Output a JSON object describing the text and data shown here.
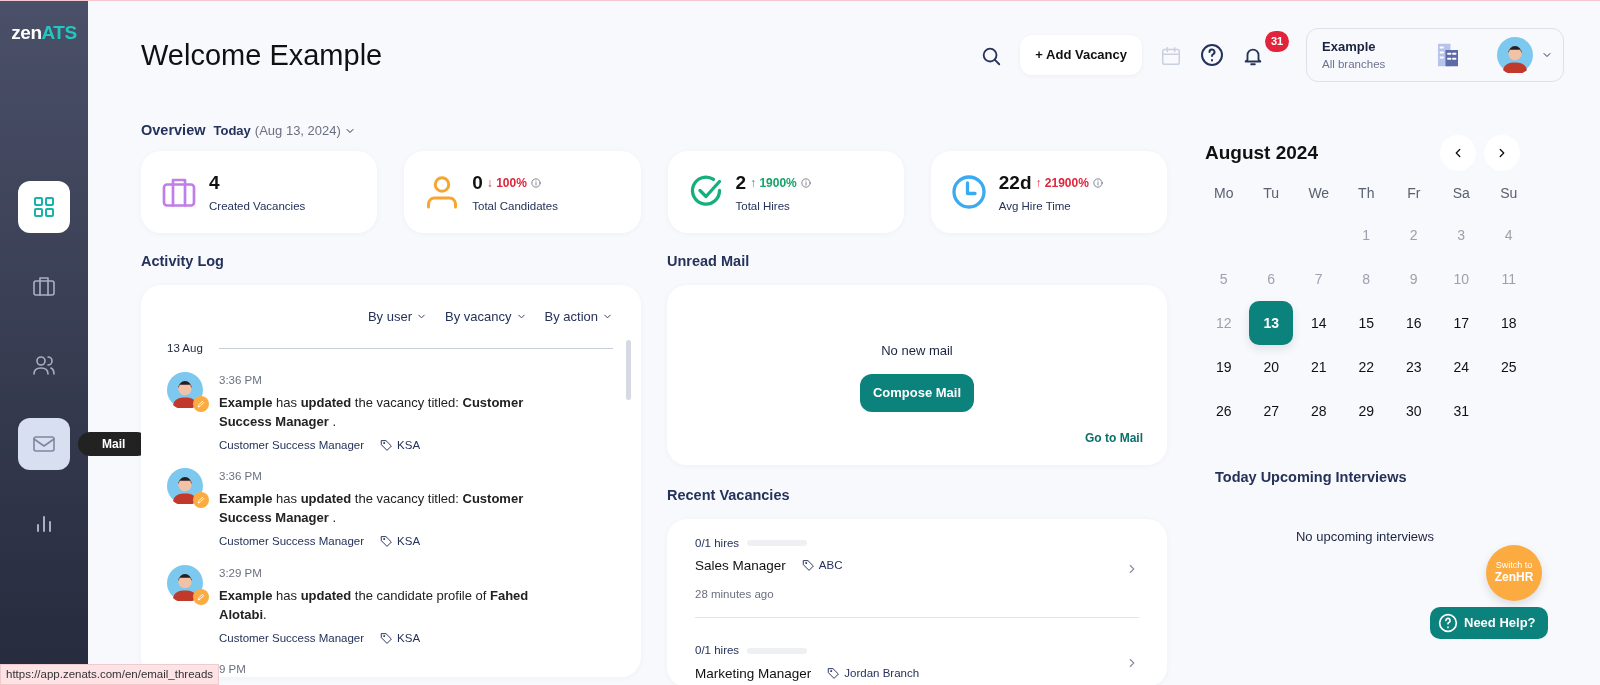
{
  "logo": {
    "part1": "zen",
    "part2": "ATS"
  },
  "sidebar": {
    "items": [
      {
        "kind": "dashboard",
        "selected": true,
        "hovered": false
      },
      {
        "kind": "vacancies",
        "selected": false,
        "hovered": false
      },
      {
        "kind": "candidates",
        "selected": false,
        "hovered": false
      },
      {
        "kind": "mail",
        "selected": false,
        "hovered": true,
        "tooltip": "Mail"
      },
      {
        "kind": "reports",
        "selected": false,
        "hovered": false
      }
    ]
  },
  "header": {
    "title": "Welcome Example",
    "add_button": "+ Add Vacancy",
    "calendar_disabled": true,
    "notifications": "31",
    "account": {
      "name": "Example",
      "scope": "All branches"
    }
  },
  "overview": {
    "title": "Overview",
    "period": "Today",
    "date": "(Aug 13, 2024)",
    "stats": [
      {
        "kind": "briefcase",
        "value": "4",
        "label": "Created Vacancies"
      },
      {
        "kind": "person",
        "value": "0",
        "delta": "↓ 100%",
        "color": "#e0243b",
        "label": "Total Candidates"
      },
      {
        "kind": "check",
        "value": "2",
        "delta": "↑ 1900%",
        "color": "#14a46a",
        "label": "Total Hires"
      },
      {
        "kind": "clock",
        "value": "22d",
        "delta": "↑ 21900%",
        "color": "#e0243b",
        "label": "Avg Hire Time"
      }
    ]
  },
  "activity_log": {
    "title": "Activity Log",
    "filters": [
      "By user",
      "By vacancy",
      "By action"
    ],
    "date": "13 Aug",
    "entries": [
      {
        "time": "3:36 PM",
        "text": "**Example** has **updated** the vacancy titled: **Customer Success Manager** .",
        "vacancy": "Customer Success Manager",
        "tag": "KSA"
      },
      {
        "time": "3:36 PM",
        "text": "**Example** has **updated** the vacancy titled: **Customer Success Manager** .",
        "vacancy": "Customer Success Manager",
        "tag": "KSA"
      },
      {
        "time": "3:29 PM",
        "text": "**Example** has **updated** the candidate profile of **Fahed Alotabi**.",
        "vacancy": "Customer Success Manager",
        "tag": "KSA"
      },
      {
        "time": "9 PM"
      }
    ]
  },
  "unread_mail": {
    "title": "Unread Mail",
    "empty_text": "No new mail",
    "compose": "Compose Mail",
    "link": "Go to Mail"
  },
  "recent_vacancies": {
    "title": "Recent Vacancies",
    "items": [
      {
        "hires": "0/1 hires",
        "level": 0,
        "title": "Sales Manager",
        "tag": "ABC",
        "time": "28 minutes ago"
      },
      {
        "hires": "0/1 hires",
        "level": 0,
        "title": "Marketing Manager",
        "tag": "Jordan Branch"
      }
    ]
  },
  "calendar": {
    "month": "August 2024",
    "weekdays": [
      "Mo",
      "Tu",
      "We",
      "Th",
      "Fr",
      "Sa",
      "Su"
    ],
    "weeks": [
      [
        {
          "kind": "blank"
        },
        {
          "kind": "blank"
        },
        {
          "kind": "blank"
        },
        {
          "kind": "day",
          "day": "1",
          "past": true,
          "selected": false
        },
        {
          "kind": "day",
          "day": "2",
          "past": true,
          "selected": false
        },
        {
          "kind": "day",
          "day": "3",
          "past": true,
          "selected": false
        },
        {
          "kind": "day",
          "day": "4",
          "past": true,
          "selected": false
        }
      ],
      [
        {
          "kind": "day",
          "day": "5",
          "past": true,
          "selected": false
        },
        {
          "kind": "day",
          "day": "6",
          "past": true,
          "selected": false
        },
        {
          "kind": "day",
          "day": "7",
          "past": true,
          "selected": false
        },
        {
          "kind": "day",
          "day": "8",
          "past": true,
          "selected": false
        },
        {
          "kind": "day",
          "day": "9",
          "past": true,
          "selected": false
        },
        {
          "kind": "day",
          "day": "10",
          "past": true,
          "selected": false
        },
        {
          "kind": "day",
          "day": "11",
          "past": true,
          "selected": false
        }
      ],
      [
        {
          "kind": "day",
          "day": "12",
          "past": true,
          "selected": false
        },
        {
          "kind": "day",
          "day": "13",
          "past": false,
          "selected": true
        },
        {
          "kind": "day",
          "day": "14",
          "past": false,
          "selected": false
        },
        {
          "kind": "day",
          "day": "15",
          "past": false,
          "selected": false
        },
        {
          "kind": "day",
          "day": "16",
          "past": false,
          "selected": false
        },
        {
          "kind": "day",
          "day": "17",
          "past": false,
          "selected": false
        },
        {
          "kind": "day",
          "day": "18",
          "past": false,
          "selected": false
        }
      ],
      [
        {
          "kind": "day",
          "day": "19",
          "past": false,
          "selected": false
        },
        {
          "kind": "day",
          "day": "20",
          "past": false,
          "selected": false
        },
        {
          "kind": "day",
          "day": "21",
          "past": false,
          "selected": false
        },
        {
          "kind": "day",
          "day": "22",
          "past": false,
          "selected": false
        },
        {
          "kind": "day",
          "day": "23",
          "past": false,
          "selected": false
        },
        {
          "kind": "day",
          "day": "24",
          "past": false,
          "selected": false
        },
        {
          "kind": "day",
          "day": "25",
          "past": false,
          "selected": false
        }
      ],
      [
        {
          "kind": "day",
          "day": "26",
          "past": false,
          "selected": false
        },
        {
          "kind": "day",
          "day": "27",
          "past": false,
          "selected": false
        },
        {
          "kind": "day",
          "day": "28",
          "past": false,
          "selected": false
        },
        {
          "kind": "day",
          "day": "29",
          "past": false,
          "selected": false
        },
        {
          "kind": "day",
          "day": "30",
          "past": false,
          "selected": false
        },
        {
          "kind": "day",
          "day": "31",
          "past": false,
          "selected": false
        }
      ]
    ]
  },
  "interviews": {
    "title": "Today Upcoming Interviews",
    "empty_text": "No upcoming interviews"
  },
  "switch_button": {
    "line1": "Switch to",
    "line2": "ZenHR"
  },
  "help_button": "Need Help?",
  "status_url": "https://app.zenats.com/en/email_threads"
}
